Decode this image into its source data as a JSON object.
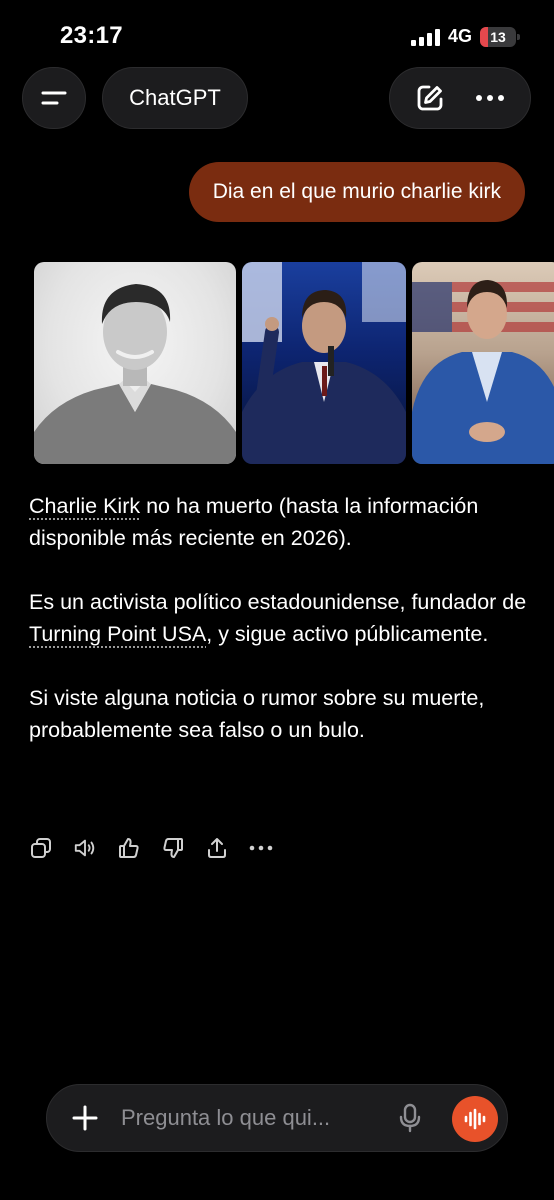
{
  "status_bar": {
    "time": "23:17",
    "network": "4G",
    "battery_level": "13",
    "battery_color": "#e5484d"
  },
  "header": {
    "menu_icon": "menu-icon",
    "title": "ChatGPT",
    "new_chat_icon": "edit-icon",
    "more_icon": "more-icon"
  },
  "chat": {
    "user_message": "Dia en el que murio charlie kirk",
    "user_bubble_color": "#7a2c10",
    "images": [
      {
        "name": "image-1"
      },
      {
        "name": "image-2"
      },
      {
        "name": "image-3"
      }
    ],
    "answer": {
      "p1_link": "Charlie Kirk",
      "p1_rest": " no ha muerto (hasta la información disponible más reciente en 2026).",
      "p2_start": "Es un activista político estadounidense, fundador de ",
      "p2_link": "Turning Point USA",
      "p2_end": ", y sigue activo públicamente.",
      "p3": "Si viste alguna noticia o rumor sobre su muerte, probablemente sea falso o un bulo."
    },
    "actions": [
      "copy-icon",
      "speaker-icon",
      "thumbs-up-icon",
      "thumbs-down-icon",
      "share-icon",
      "more-icon"
    ]
  },
  "composer": {
    "placeholder": "Pregunta lo que qui...",
    "plus_icon": "plus-icon",
    "mic_icon": "mic-icon",
    "voice_icon": "voice-mode-icon",
    "accent": "#e8522a"
  }
}
